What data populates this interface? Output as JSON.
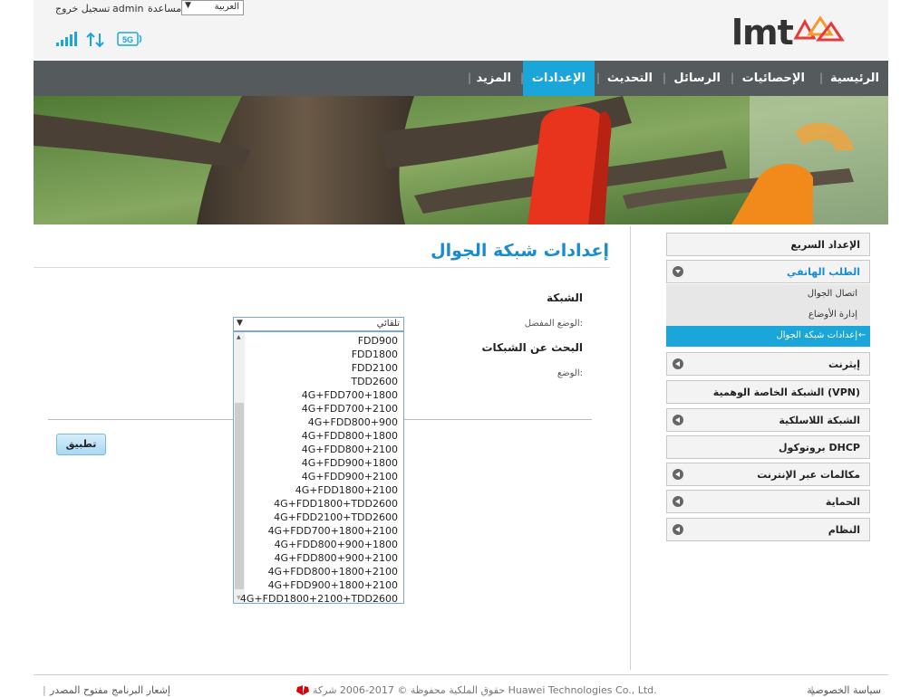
{
  "header": {
    "language": "العربية",
    "help": "مساعدة",
    "user": "admin",
    "logout": "تسجيل خروج",
    "logo": "lmt",
    "network_badge": "5G"
  },
  "nav": {
    "items": [
      "الرئيسية",
      "الإحصائيات",
      "الرسائل",
      "التحديث",
      "الإعدادات",
      "المزيد"
    ],
    "active": "الإعدادات"
  },
  "sidebar": {
    "items": [
      {
        "label": "الإعداد السريع"
      },
      {
        "label": "الطلب الهاتفي"
      },
      {
        "label": "إيثرنت"
      },
      {
        "label": "الشبكة الخاصة الوهمية (VPN)"
      },
      {
        "label": "الشبكة اللاسلكية"
      },
      {
        "label": "بروتوكول DHCP"
      },
      {
        "label": "مكالمات عبر الإنترنت"
      },
      {
        "label": "الحماية"
      },
      {
        "label": "النظام"
      }
    ],
    "subitems": [
      "اتصال الجوال",
      "إدارة الأوضاع",
      "إعدادات شبكة الجوال"
    ]
  },
  "main": {
    "title": "إعدادات شبكة الجوال",
    "network_heading": "الشبكة",
    "preferred_mode_label": "الوضع المفضل:",
    "preferred_mode_value": "تلقائي",
    "search_heading": "البحث عن الشبكات",
    "mode_label": "الوضع:",
    "apply_label": "تطبيق",
    "dropdown_options": [
      "FDD900",
      "FDD1800",
      "FDD2100",
      "TDD2600",
      "4G+FDD700+1800",
      "4G+FDD700+2100",
      "4G+FDD800+900",
      "4G+FDD800+1800",
      "4G+FDD800+2100",
      "4G+FDD900+1800",
      "4G+FDD900+2100",
      "4G+FDD1800+2100",
      "4G+FDD1800+TDD2600",
      "4G+FDD2100+TDD2600",
      "4G+FDD700+1800+2100",
      "4G+FDD800+900+1800",
      "4G+FDD800+900+2100",
      "4G+FDD800+1800+2100",
      "4G+FDD900+1800+2100",
      "4G+FDD1800+2100+TDD2600"
    ]
  },
  "footer": {
    "privacy": "سياسة الخصوصية",
    "copyright": "حقوق الملكية محفوظة © 2017-2006 شركة Huawei Technologies Co., Ltd.",
    "open_source": "إشعار البرنامج مفتوح المصدر"
  },
  "colors": {
    "accent": "#1aa6d9",
    "nav_bg": "#555a5c",
    "title": "#1a8ccc"
  }
}
